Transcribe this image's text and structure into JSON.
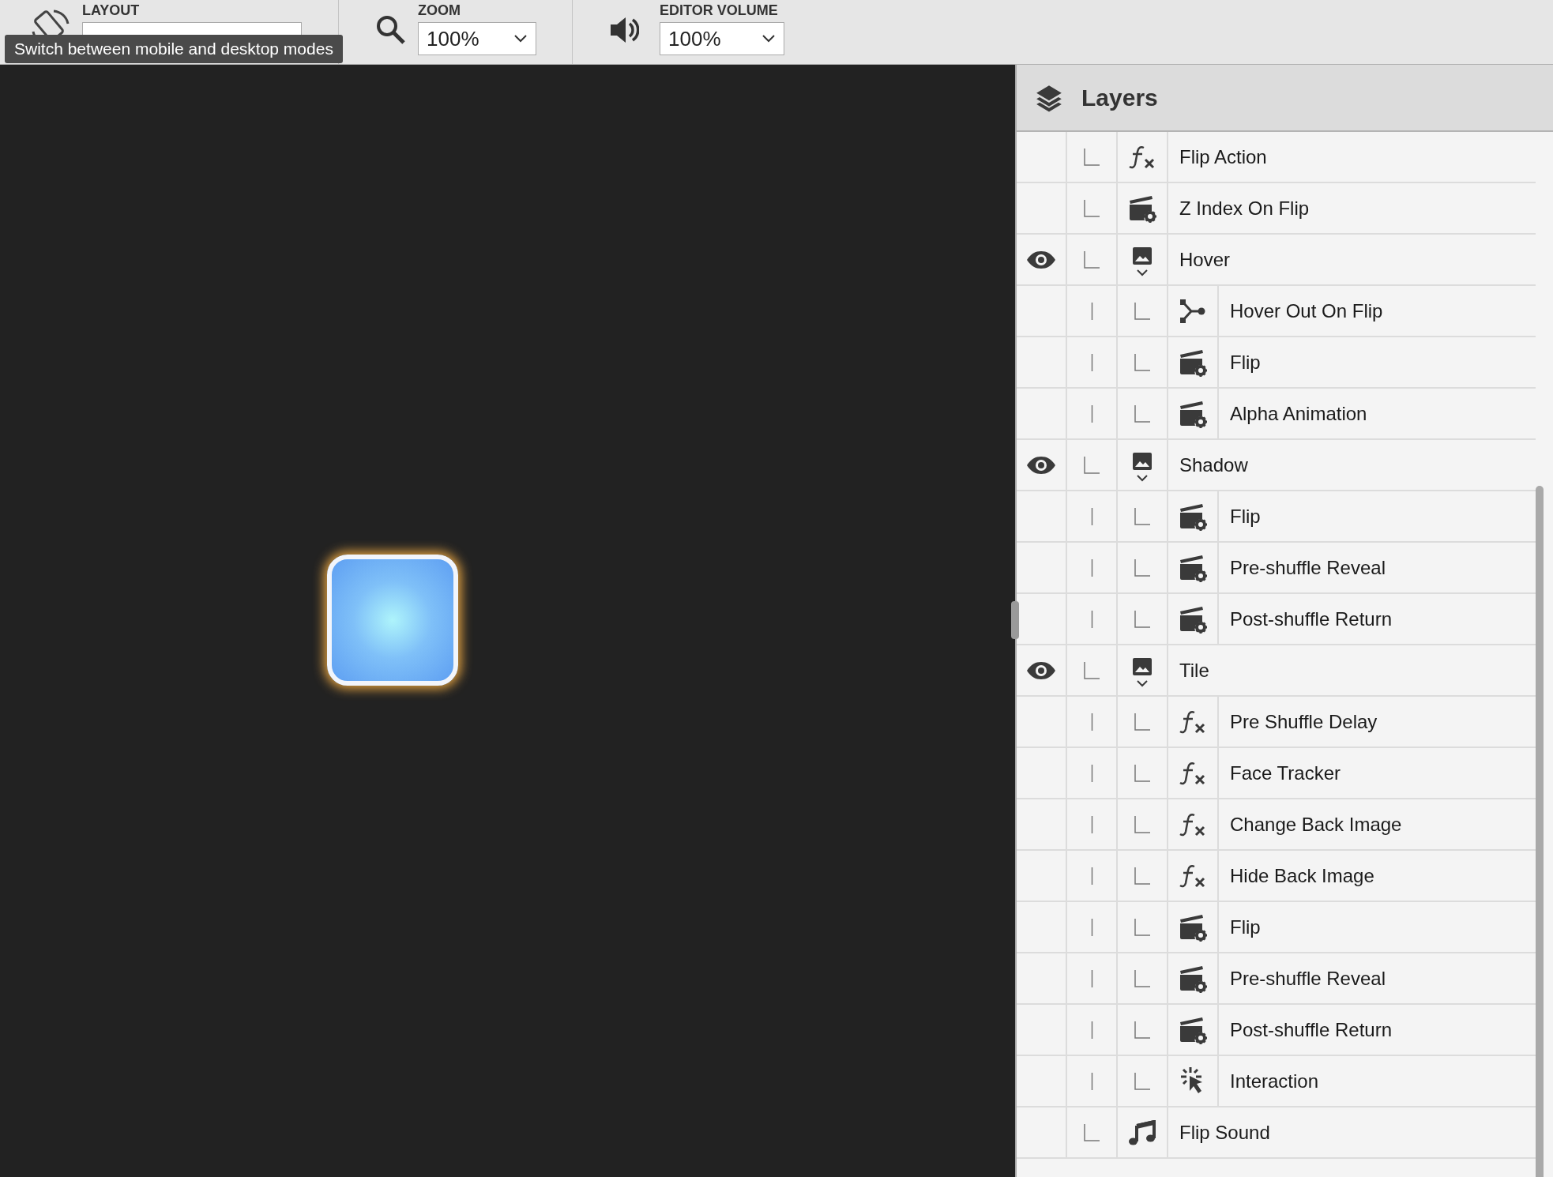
{
  "toolbar": {
    "layout": {
      "label": "LAYOUT",
      "tooltip": "Switch between mobile and desktop modes"
    },
    "zoom": {
      "label": "ZOOM",
      "value": "100%"
    },
    "volume": {
      "label": "EDITOR VOLUME",
      "value": "100%"
    }
  },
  "layers": {
    "title": "Layers",
    "items": [
      {
        "name": "Flip Action",
        "kind": "function",
        "visible": false
      },
      {
        "name": "Z Index On Flip",
        "kind": "animation",
        "visible": false
      },
      {
        "name": "Hover",
        "kind": "image",
        "visible": true,
        "expanded": true,
        "children": [
          {
            "name": "Hover Out On Flip",
            "kind": "branch",
            "visible": false
          },
          {
            "name": "Flip",
            "kind": "animation",
            "visible": false
          },
          {
            "name": "Alpha Animation",
            "kind": "animation",
            "visible": false
          }
        ]
      },
      {
        "name": "Shadow",
        "kind": "image",
        "visible": true,
        "expanded": true,
        "children": [
          {
            "name": "Flip",
            "kind": "animation",
            "visible": false
          },
          {
            "name": "Pre-shuffle Reveal",
            "kind": "animation",
            "visible": false
          },
          {
            "name": "Post-shuffle Return",
            "kind": "animation",
            "visible": false
          }
        ]
      },
      {
        "name": "Tile",
        "kind": "image",
        "visible": true,
        "expanded": true,
        "children": [
          {
            "name": "Pre Shuffle Delay",
            "kind": "function",
            "visible": false
          },
          {
            "name": "Face Tracker",
            "kind": "function",
            "visible": false
          },
          {
            "name": "Change Back Image",
            "kind": "function",
            "visible": false
          },
          {
            "name": "Hide Back Image",
            "kind": "function",
            "visible": false
          },
          {
            "name": "Flip",
            "kind": "animation",
            "visible": false
          },
          {
            "name": "Pre-shuffle Reveal",
            "kind": "animation",
            "visible": false
          },
          {
            "name": "Post-shuffle Return",
            "kind": "animation",
            "visible": false
          },
          {
            "name": "Interaction",
            "kind": "interaction",
            "visible": false
          }
        ]
      },
      {
        "name": "Flip Sound",
        "kind": "sound",
        "visible": false
      }
    ]
  }
}
